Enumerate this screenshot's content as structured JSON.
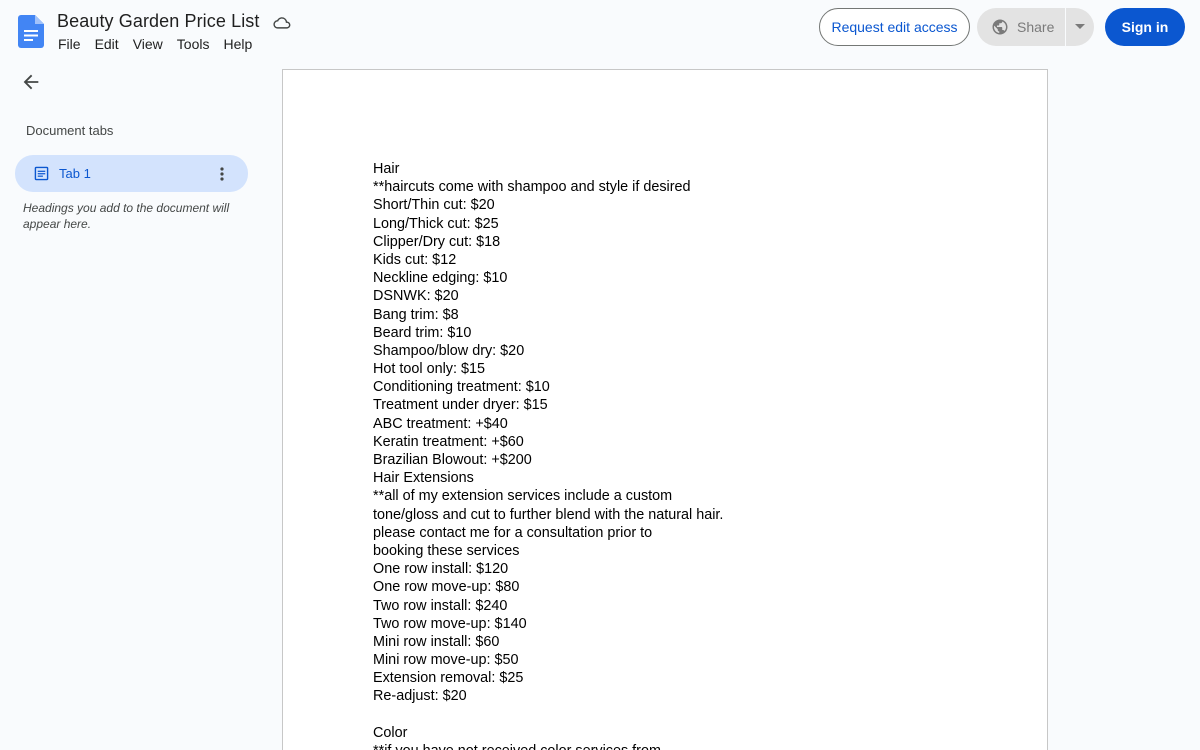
{
  "app": {
    "title": "Beauty Garden Price List",
    "accent_color": "#0b57d0",
    "icons": {
      "logo": "google-docs-icon",
      "cloud": "cloud-saved-icon",
      "share": "globe-icon",
      "back": "arrow-back-icon"
    }
  },
  "menu": [
    "File",
    "Edit",
    "View",
    "Tools",
    "Help"
  ],
  "toolbar": {
    "request_edit_label": "Request edit access",
    "share_label": "Share",
    "sign_in_label": "Sign in"
  },
  "sidebar": {
    "heading": "Document tabs",
    "tabs": [
      {
        "label": "Tab 1"
      }
    ],
    "note": "Headings you add to the document will appear here."
  },
  "document": {
    "lines": [
      "Hair",
      "**haircuts come with shampoo and style if desired",
      "Short/Thin cut: $20",
      "Long/Thick cut: $25",
      "Clipper/Dry cut: $18",
      "Kids cut: $12",
      "Neckline edging: $10",
      "DSNWK: $20",
      "Bang trim: $8",
      "Beard trim: $10",
      "Shampoo/blow dry: $20",
      "Hot tool only: $15",
      "Conditioning treatment: $10",
      "Treatment under dryer: $15",
      "ABC treatment: +$40",
      "Keratin treatment: +$60",
      "Brazilian Blowout: +$200",
      "Hair Extensions",
      "**all of my extension services include a custom",
      "tone/gloss and cut to further blend with the natural hair.",
      "please contact me for a consultation prior to",
      "booking these services",
      "One row install: $120",
      "One row move-up: $80",
      "Two row install: $240",
      "Two row move-up: $140",
      "Mini row install: $60",
      "Mini row move-up: $50",
      "Extension removal: $25",
      "Re-adjust: $20",
      "",
      "Color",
      "**if you have not received color services from"
    ]
  }
}
